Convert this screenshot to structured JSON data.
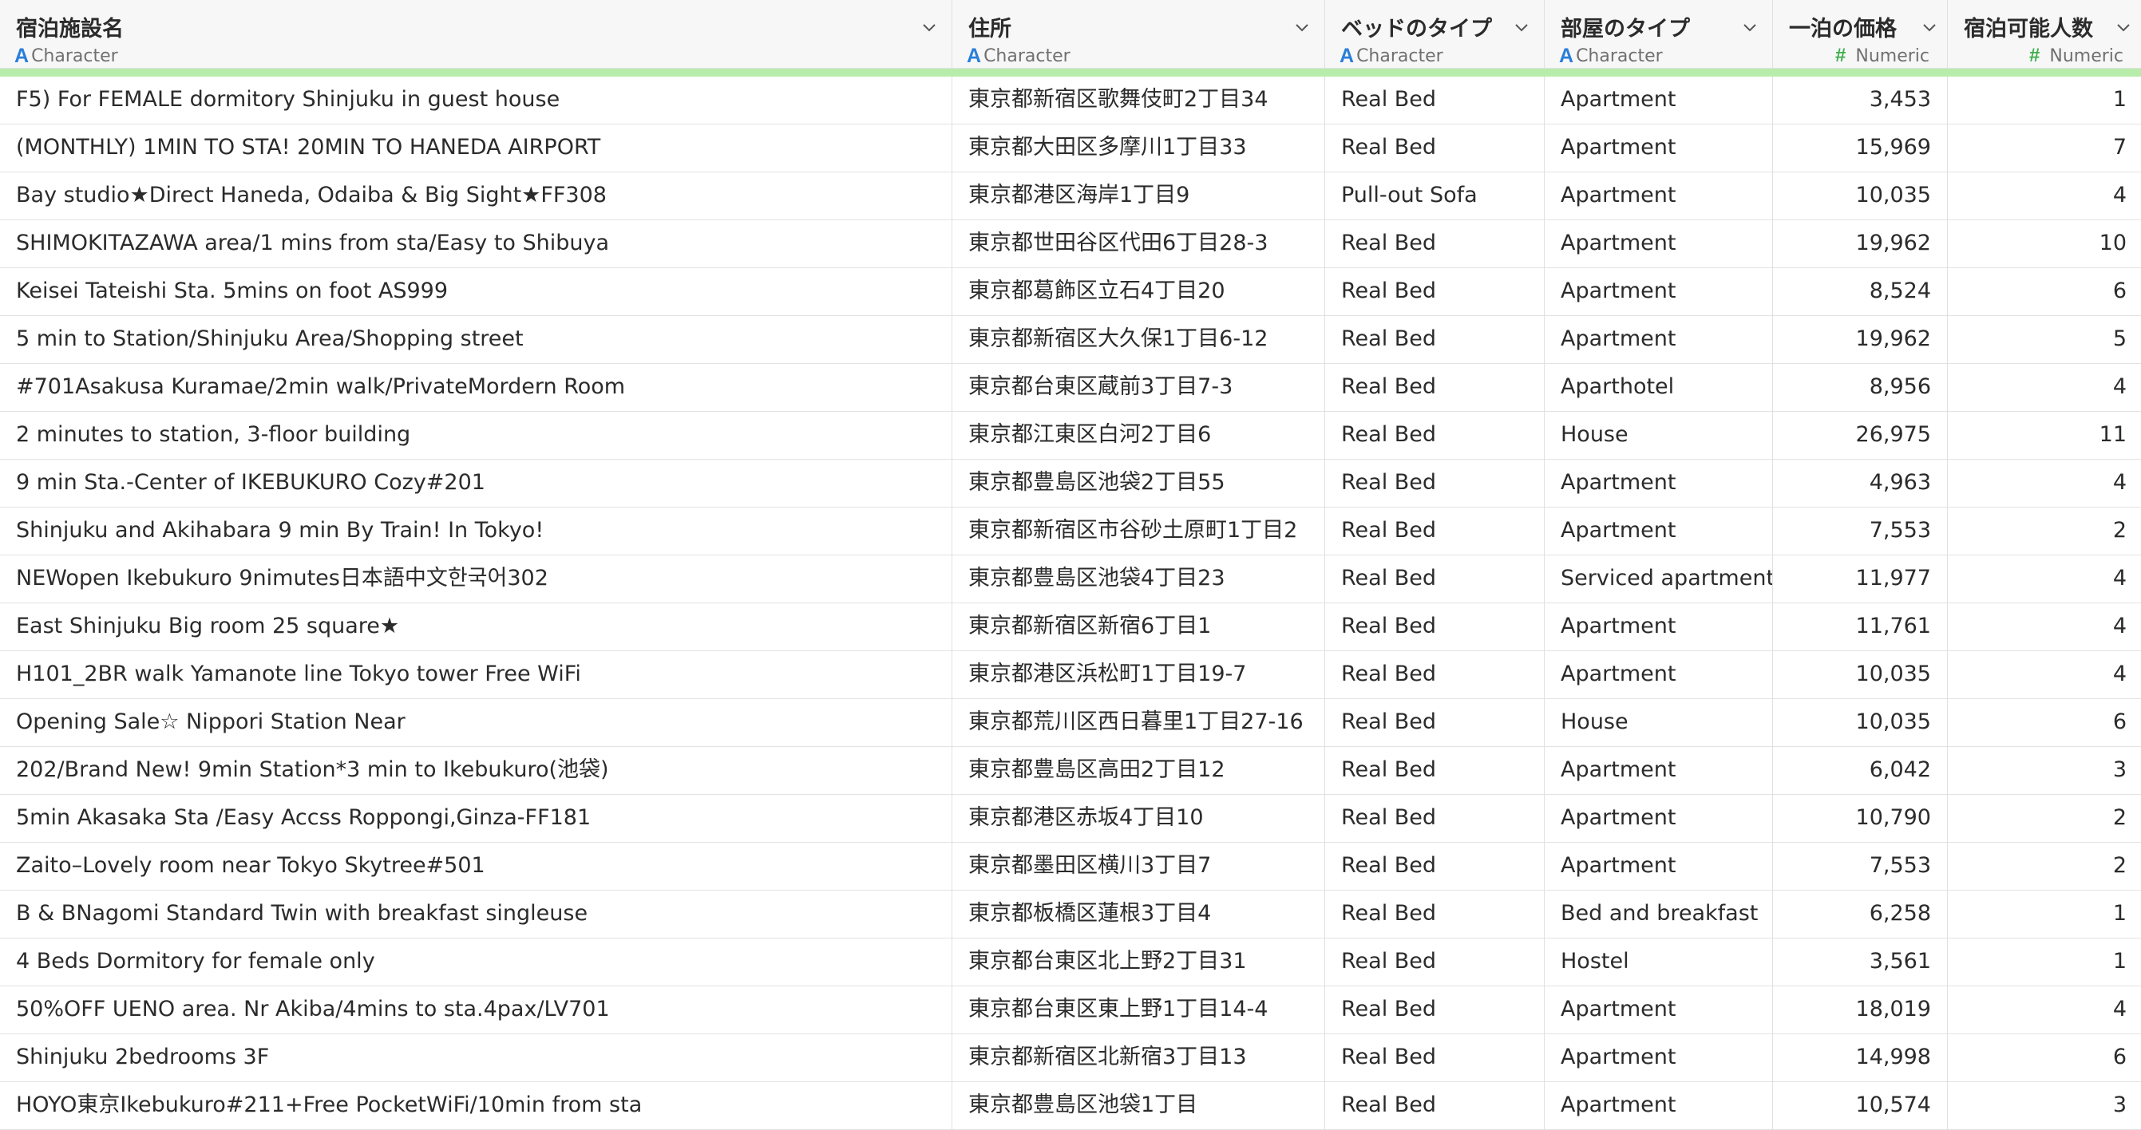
{
  "columns": [
    {
      "name": "宿泊施設名",
      "type": "Character",
      "kind": "char"
    },
    {
      "name": "住所",
      "type": "Character",
      "kind": "char"
    },
    {
      "name": "ベッドのタイプ",
      "type": "Character",
      "kind": "char"
    },
    {
      "name": "部屋のタイプ",
      "type": "Character",
      "kind": "char"
    },
    {
      "name": "一泊の価格",
      "type": "Numeric",
      "kind": "num"
    },
    {
      "name": "宿泊可能人数",
      "type": "Numeric",
      "kind": "num"
    }
  ],
  "icons": {
    "character_type_icon": "A",
    "numeric_type_icon": "#",
    "column_menu_icon": "chevron-down"
  },
  "colors": {
    "character_icon": "#2a7ed8",
    "numeric_icon": "#3cae4a",
    "quality_bar": "#b8ecaa",
    "header_bg": "#f7f7f8"
  },
  "rows": [
    [
      "F5) For FEMALE dormitory Shinjuku in guest house",
      "東京都新宿区歌舞伎町2丁目34",
      "Real Bed",
      "Apartment",
      "3,453",
      "1"
    ],
    [
      "(MONTHLY) 1MIN TO STA! 20MIN TO HANEDA AIRPORT",
      "東京都大田区多摩川1丁目33",
      "Real Bed",
      "Apartment",
      "15,969",
      "7"
    ],
    [
      "Bay studio★Direct Haneda, Odaiba & Big Sight★FF308",
      "東京都港区海岸1丁目9",
      "Pull-out Sofa",
      "Apartment",
      "10,035",
      "4"
    ],
    [
      "SHIMOKITAZAWA area/1 mins from sta/Easy to Shibuya",
      "東京都世田谷区代田6丁目28-3",
      "Real Bed",
      "Apartment",
      "19,962",
      "10"
    ],
    [
      "Keisei Tateishi Sta. 5mins on foot AS999",
      "東京都葛飾区立石4丁目20",
      "Real Bed",
      "Apartment",
      "8,524",
      "6"
    ],
    [
      "5 min to Station/Shinjuku Area/Shopping street",
      "東京都新宿区大久保1丁目6-12",
      "Real Bed",
      "Apartment",
      "19,962",
      "5"
    ],
    [
      "#701Asakusa Kuramae/2min walk/PrivateMordern Room",
      "東京都台東区蔵前3丁目7-3",
      "Real Bed",
      "Aparthotel",
      "8,956",
      "4"
    ],
    [
      "2 minutes to station, 3-floor building",
      "東京都江東区白河2丁目6",
      "Real Bed",
      "House",
      "26,975",
      "11"
    ],
    [
      "9 min Sta.-Center of IKEBUKURO Cozy#201",
      "東京都豊島区池袋2丁目55",
      "Real Bed",
      "Apartment",
      "4,963",
      "4"
    ],
    [
      "Shinjuku and Akihabara 9 min By Train! In Tokyo!",
      "東京都新宿区市谷砂土原町1丁目2",
      "Real Bed",
      "Apartment",
      "7,553",
      "2"
    ],
    [
      "NEWopen Ikebukuro 9nimutes日本語中文한국어302",
      "東京都豊島区池袋4丁目23",
      "Real Bed",
      "Serviced apartment",
      "11,977",
      "4"
    ],
    [
      "East Shinjuku Big room 25 square★",
      "東京都新宿区新宿6丁目1",
      "Real Bed",
      "Apartment",
      "11,761",
      "4"
    ],
    [
      "H101_2BR walk Yamanote line Tokyo tower Free WiFi",
      "東京都港区浜松町1丁目19-7",
      "Real Bed",
      "Apartment",
      "10,035",
      "4"
    ],
    [
      "Opening Sale☆ Nippori Station Near",
      "東京都荒川区西日暮里1丁目27-16",
      "Real Bed",
      "House",
      "10,035",
      "6"
    ],
    [
      "202/Brand New! 9min Station*3 min to Ikebukuro(池袋)",
      "東京都豊島区高田2丁目12",
      "Real Bed",
      "Apartment",
      "6,042",
      "3"
    ],
    [
      "5min Akasaka Sta /Easy Accss Roppongi,Ginza-FF181",
      "東京都港区赤坂4丁目10",
      "Real Bed",
      "Apartment",
      "10,790",
      "2"
    ],
    [
      "Zaito–Lovely room near Tokyo Skytree#501",
      "東京都墨田区横川3丁目7",
      "Real Bed",
      "Apartment",
      "7,553",
      "2"
    ],
    [
      "B & BNagomi Standard Twin with breakfast singleuse",
      "東京都板橋区蓮根3丁目4",
      "Real Bed",
      "Bed and breakfast",
      "6,258",
      "1"
    ],
    [
      "4 Beds Dormitory for female only",
      "東京都台東区北上野2丁目31",
      "Real Bed",
      "Hostel",
      "3,561",
      "1"
    ],
    [
      "50%OFF UENO area. Nr Akiba/4mins to sta.4pax/LV701",
      "東京都台東区東上野1丁目14-4",
      "Real Bed",
      "Apartment",
      "18,019",
      "4"
    ],
    [
      "Shinjuku 2bedrooms 3F",
      "東京都新宿区北新宿3丁目13",
      "Real Bed",
      "Apartment",
      "14,998",
      "6"
    ],
    [
      "HOYO東京Ikebukuro#211+Free PocketWiFi/10min from sta",
      "東京都豊島区池袋1丁目",
      "Real Bed",
      "Apartment",
      "10,574",
      "3"
    ]
  ]
}
